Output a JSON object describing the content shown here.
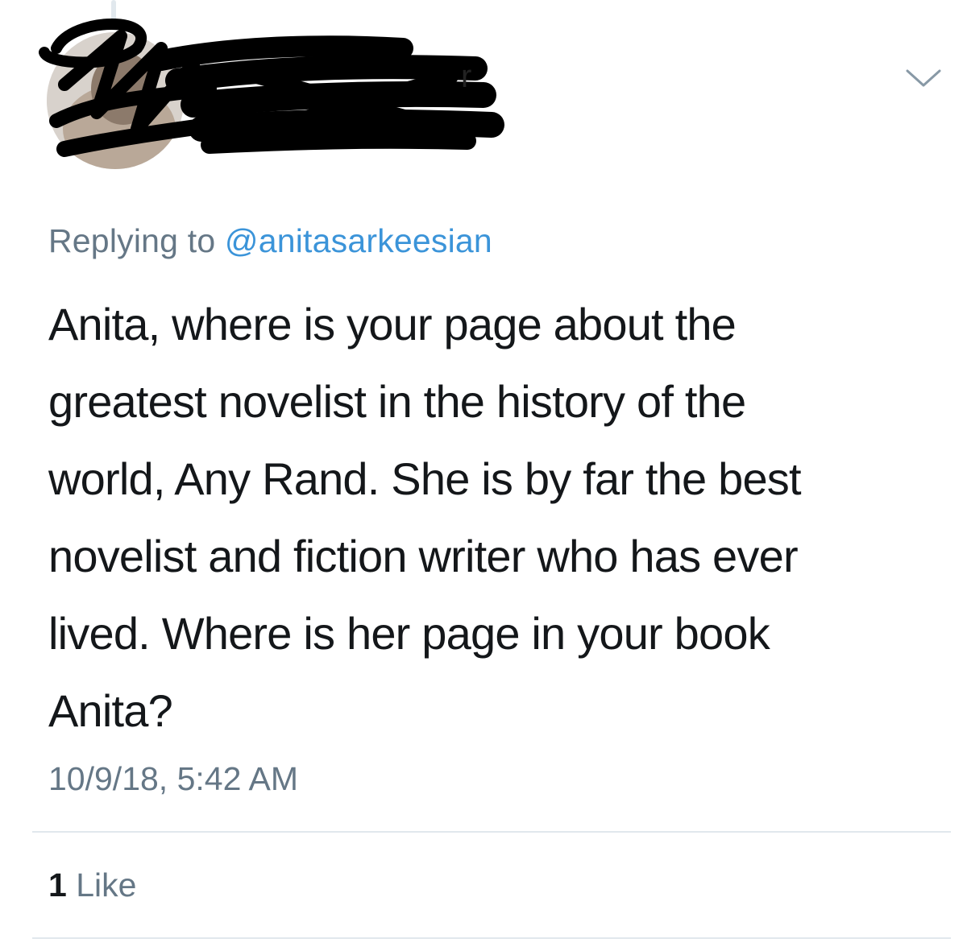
{
  "tweet": {
    "replying_prefix": "Replying to",
    "replying_handle": "@anitasarkeesian",
    "text_lines": [
      "Anita, where is your page about the",
      "greatest novelist in the history of the",
      "world, Any Rand.  She is by far the best",
      "novelist and fiction writer who has ever",
      "lived.  Where is her page in your book",
      "Anita?"
    ],
    "timestamp": "10/9/18, 5:42 AM",
    "like_count": "1",
    "like_label": "Like"
  },
  "icons": {
    "menu": "chevron-down-icon",
    "avatar": "avatar",
    "redaction": "redaction-scribble"
  },
  "colors": {
    "text": "#14171a",
    "secondary_text": "#657786",
    "link": "#3b94d9",
    "divider": "#e1e8ed",
    "redaction": "#000000"
  }
}
